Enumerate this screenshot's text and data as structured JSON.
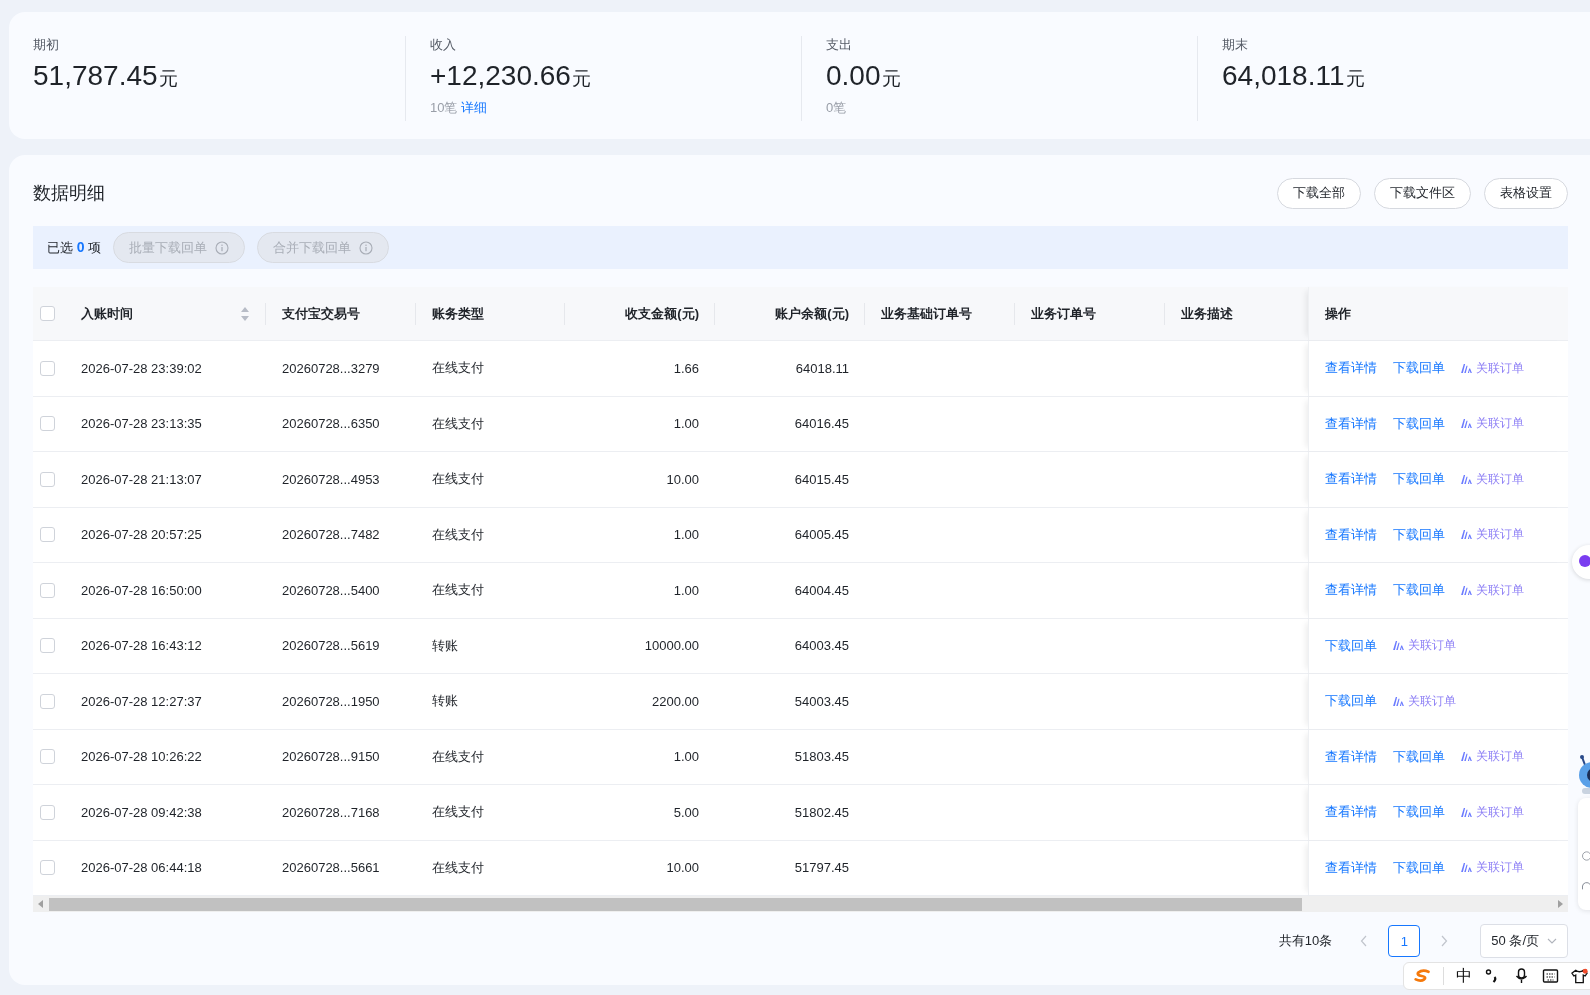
{
  "summary": [
    {
      "label": "期初",
      "amount": "51,787.45",
      "unit": "元"
    },
    {
      "label": "收入",
      "amount": "+12,230.66",
      "unit": "元",
      "count": "10笔",
      "link": "详细"
    },
    {
      "label": "支出",
      "amount": "0.00",
      "unit": "元",
      "count": "0笔"
    },
    {
      "label": "期末",
      "amount": "64,018.11",
      "unit": "元"
    }
  ],
  "section_title": "数据明细",
  "header_buttons": [
    "下载全部",
    "下载文件区",
    "表格设置"
  ],
  "selection": {
    "prefix": "已选",
    "count": "0",
    "suffix": "项",
    "buttons": [
      {
        "label": "批量下载回单",
        "disabled": true
      },
      {
        "label": "合并下载回单",
        "disabled": true
      }
    ]
  },
  "table": {
    "select_all": {
      "checked": false
    },
    "columns": [
      {
        "label": "入账时间",
        "kind": "sort"
      },
      {
        "label": "支付宝交易号",
        "kind": "text"
      },
      {
        "label": "账务类型",
        "kind": "text"
      },
      {
        "label": "收支金额(元)",
        "kind": "num"
      },
      {
        "label": "账户余额(元)",
        "kind": "num"
      },
      {
        "label": "业务基础订单号",
        "kind": "text"
      },
      {
        "label": "业务订单号",
        "kind": "text"
      },
      {
        "label": "业务描述",
        "kind": "text"
      },
      {
        "label": "操作",
        "kind": "ops"
      }
    ],
    "rows": [
      {
        "checked": false,
        "time": "2026-07-28 23:39:02",
        "txn": "20260728...3279",
        "type": "在线支付",
        "amount": "1.66",
        "balance": "64018.11",
        "actions": [
          "查看详情",
          "下载回单"
        ],
        "linked": "关联订单"
      },
      {
        "checked": false,
        "time": "2026-07-28 23:13:35",
        "txn": "20260728...6350",
        "type": "在线支付",
        "amount": "1.00",
        "balance": "64016.45",
        "actions": [
          "查看详情",
          "下载回单"
        ],
        "linked": "关联订单"
      },
      {
        "checked": false,
        "time": "2026-07-28 21:13:07",
        "txn": "20260728...4953",
        "type": "在线支付",
        "amount": "10.00",
        "balance": "64015.45",
        "actions": [
          "查看详情",
          "下载回单"
        ],
        "linked": "关联订单"
      },
      {
        "checked": false,
        "time": "2026-07-28 20:57:25",
        "txn": "20260728...7482",
        "type": "在线支付",
        "amount": "1.00",
        "balance": "64005.45",
        "actions": [
          "查看详情",
          "下载回单"
        ],
        "linked": "关联订单"
      },
      {
        "checked": false,
        "time": "2026-07-28 16:50:00",
        "txn": "20260728...5400",
        "type": "在线支付",
        "amount": "1.00",
        "balance": "64004.45",
        "actions": [
          "查看详情",
          "下载回单"
        ],
        "linked": "关联订单"
      },
      {
        "checked": false,
        "time": "2026-07-28 16:43:12",
        "txn": "20260728...5619",
        "type": "转账",
        "amount": "10000.00",
        "balance": "64003.45",
        "actions": [
          "下载回单"
        ],
        "linked": "关联订单"
      },
      {
        "checked": false,
        "time": "2026-07-28 12:27:37",
        "txn": "20260728...1950",
        "type": "转账",
        "amount": "2200.00",
        "balance": "54003.45",
        "actions": [
          "下载回单"
        ],
        "linked": "关联订单"
      },
      {
        "checked": false,
        "time": "2026-07-28 10:26:22",
        "txn": "20260728...9150",
        "type": "在线支付",
        "amount": "1.00",
        "balance": "51803.45",
        "actions": [
          "查看详情",
          "下载回单"
        ],
        "linked": "关联订单"
      },
      {
        "checked": false,
        "time": "2026-07-28 09:42:38",
        "txn": "20260728...7168",
        "type": "在线支付",
        "amount": "5.00",
        "balance": "51802.45",
        "actions": [
          "查看详情",
          "下载回单"
        ],
        "linked": "关联订单"
      },
      {
        "checked": false,
        "time": "2026-07-28 06:44:18",
        "txn": "20260728...5661",
        "type": "在线支付",
        "amount": "10.00",
        "balance": "51797.45",
        "actions": [
          "查看详情",
          "下载回单"
        ],
        "linked": "关联订单"
      }
    ]
  },
  "pagination": {
    "total": "共有10条",
    "pages": [
      {
        "label": "1",
        "selected": true
      }
    ],
    "page_size": "50 条/页"
  },
  "ime_bar": {
    "mode": "中"
  }
}
